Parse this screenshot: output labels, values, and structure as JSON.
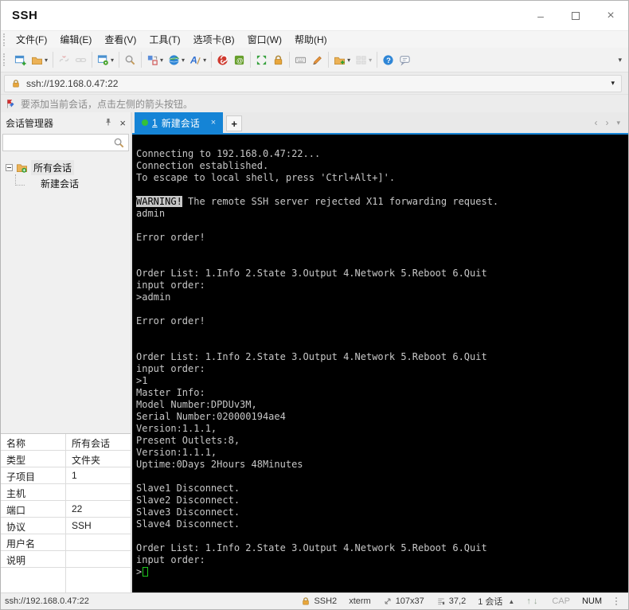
{
  "window": {
    "title": "SSH",
    "minimize_glyph": "–",
    "maximize_glyph": "□",
    "close_glyph": "×"
  },
  "menu": {
    "items": [
      "文件(F)",
      "编辑(E)",
      "查看(V)",
      "工具(T)",
      "选项卡(B)",
      "窗口(W)",
      "帮助(H)"
    ]
  },
  "toolbar": {
    "overflow_glyph": "▾",
    "groups": [
      [
        {
          "name": "new-session-button",
          "icon": "window-plus"
        },
        {
          "name": "open-session-button",
          "icon": "folder",
          "dropdown": true
        }
      ],
      [
        {
          "name": "disconnect-button",
          "icon": "broken-link",
          "disabled": true
        },
        {
          "name": "reconnect-button",
          "icon": "link",
          "disabled": true
        }
      ],
      [
        {
          "name": "session-properties-button",
          "icon": "window-gear",
          "dropdown": true
        }
      ],
      [
        {
          "name": "find-button",
          "icon": "magnifier"
        }
      ],
      [
        {
          "name": "compose-button",
          "icon": "compose",
          "dropdown": true
        },
        {
          "name": "encoding-button",
          "icon": "globe",
          "dropdown": true
        },
        {
          "name": "font-button",
          "icon": "font-a",
          "dropdown": true
        }
      ],
      [
        {
          "name": "xshell-button",
          "icon": "spiral"
        },
        {
          "name": "xftp-button",
          "icon": "xftp"
        }
      ],
      [
        {
          "name": "fullscreen-button",
          "icon": "expand"
        },
        {
          "name": "lock-screen-button",
          "icon": "lock"
        }
      ],
      [
        {
          "name": "virtual-keyboard-button",
          "icon": "keyboard"
        },
        {
          "name": "highlight-button",
          "icon": "pen"
        }
      ],
      [
        {
          "name": "new-folder-button",
          "icon": "folder-plus",
          "dropdown": true
        },
        {
          "name": "layout-button",
          "icon": "grid",
          "dropdown": true,
          "disabled": true
        }
      ],
      [
        {
          "name": "help-button",
          "icon": "help"
        },
        {
          "name": "feedback-button",
          "icon": "speech"
        }
      ]
    ]
  },
  "address_bar": {
    "icon": "lock-icon",
    "value": "ssh://192.168.0.47:22",
    "dropdown_glyph": "▾"
  },
  "notice": {
    "icon": "flag-icon",
    "text": "要添加当前会话，点击左侧的箭头按钮。"
  },
  "session_manager": {
    "title": "会话管理器",
    "pin_icon": "pin-icon",
    "close_icon": "close-icon",
    "search_placeholder": "",
    "tree": [
      {
        "label": "所有会话",
        "icon": "tree-folder-icon",
        "expanded": true
      },
      {
        "label": "新建会话"
      }
    ]
  },
  "tabs": {
    "active_index": "1",
    "active_label": "新建会话",
    "close_glyph": "×",
    "new_tab_glyph": "+",
    "scroll_left_glyph": "‹",
    "scroll_right_glyph": "›",
    "menu_glyph": "▾",
    "indicator_color": "#35c13a"
  },
  "terminal": {
    "bg": "#000000",
    "fg": "#c7c7c7",
    "cursor_color": "#1ec81e",
    "lines": [
      "Connecting to 192.168.0.47:22...",
      "Connection established.",
      "To escape to local shell, press 'Ctrl+Alt+]'.",
      "",
      {
        "segments": [
          {
            "text": "WARNING!",
            "style": "invert"
          },
          {
            "text": " The remote SSH server rejected X11 forwarding request."
          }
        ]
      },
      "admin",
      "",
      "Error order!",
      "",
      "",
      "Order List: 1.Info 2.State 3.Output 4.Network 5.Reboot 6.Quit",
      "input order:",
      ">admin",
      "",
      "Error order!",
      "",
      "",
      "Order List: 1.Info 2.State 3.Output 4.Network 5.Reboot 6.Quit",
      "input order:",
      ">1",
      "Master Info:",
      "Model Number:DPDUv3M,",
      "Serial Number:020000194ae4",
      "Version:1.1.1,",
      "Present Outlets:8,",
      "Version:1.1.1,",
      "Uptime:0Days 2Hours 48Minutes",
      "",
      "Slave1 Disconnect.",
      "Slave2 Disconnect.",
      "Slave3 Disconnect.",
      "Slave4 Disconnect.",
      "",
      "Order List: 1.Info 2.State 3.Output 4.Network 5.Reboot 6.Quit",
      "input order:",
      {
        "segments": [
          {
            "text": ">"
          },
          {
            "text": "",
            "style": "cursor"
          }
        ]
      }
    ]
  },
  "properties": {
    "rows": [
      {
        "label": "名称",
        "value": "所有会话"
      },
      {
        "label": "类型",
        "value": "文件夹"
      },
      {
        "label": "子项目",
        "value": "1"
      },
      {
        "label": "主机",
        "value": ""
      },
      {
        "label": "端口",
        "value": "22"
      },
      {
        "label": "协议",
        "value": "SSH"
      },
      {
        "label": "用户名",
        "value": ""
      },
      {
        "label": "说明",
        "value": ""
      }
    ]
  },
  "status_bar": {
    "address": "ssh://192.168.0.47:22",
    "encryption": "SSH2",
    "terminal_type": "xterm",
    "screen_size": "107x37",
    "cursor_position": "37,2",
    "session_count": "1 会话",
    "session_menu_glyph": "▲",
    "scroll_up_glyph": "↑",
    "scroll_down_glyph": "↓",
    "cap_label": "CAP",
    "num_label": "NUM"
  },
  "colors": {
    "accent": "#1584d6",
    "lock": "#e0a23c",
    "terminal_green": "#1ec81e"
  }
}
